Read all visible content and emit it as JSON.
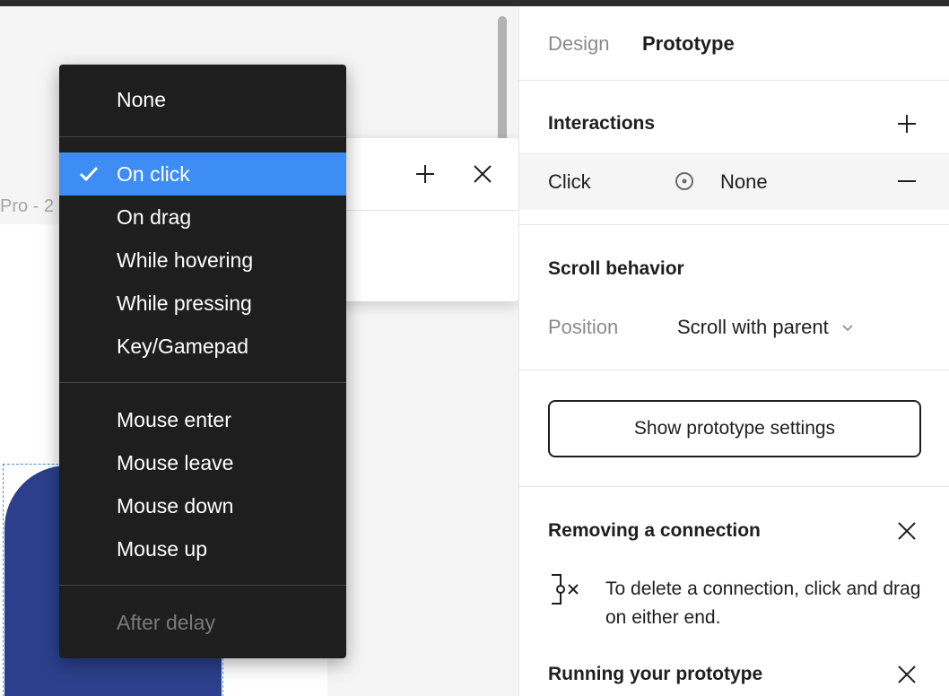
{
  "canvas": {
    "frame_label": "Pro - 2"
  },
  "menu": {
    "items_group1": [
      "None"
    ],
    "items_group2": [
      "On click",
      "On drag",
      "While hovering",
      "While pressing",
      "Key/Gamepad"
    ],
    "items_group3": [
      "Mouse enter",
      "Mouse leave",
      "Mouse down",
      "Mouse up"
    ],
    "items_group4": [
      "After delay"
    ],
    "selected": "On click",
    "disabled": [
      "After delay"
    ]
  },
  "panel": {
    "tabs": [
      "Design",
      "Prototype"
    ],
    "active_tab": "Prototype",
    "interactions": {
      "title": "Interactions",
      "trigger": "Click",
      "action": "None"
    },
    "scroll_behavior": {
      "title": "Scroll behavior",
      "label": "Position",
      "value": "Scroll with parent"
    },
    "settings_button": "Show prototype settings",
    "tip_removing": {
      "title": "Removing a connection",
      "text": "To delete a connection, click and drag on either end."
    },
    "tip_running": {
      "title": "Running your prototype"
    }
  },
  "colors": {
    "accent": "#3d8df5",
    "menu_bg": "#1e1e1e",
    "shape_blue": "#2b3f8c"
  }
}
